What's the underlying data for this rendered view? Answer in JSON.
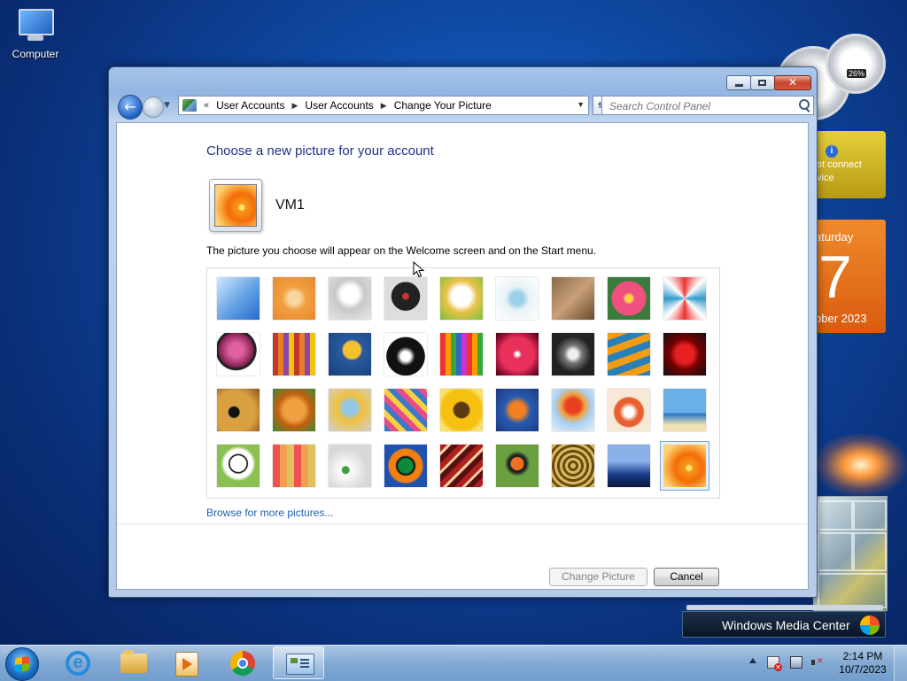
{
  "desktop": {
    "icons": [
      {
        "label": "Computer"
      }
    ]
  },
  "gadgets": {
    "cpu_meter": {
      "percent": "26%"
    },
    "weather": {
      "line1": "ot connect",
      "line2": "vice"
    },
    "calendar": {
      "day": "aturday",
      "date": "7",
      "month": "ober 2023"
    },
    "media_center": {
      "label": "Windows Media Center"
    }
  },
  "window": {
    "caption_buttons": {
      "minimize": "minimize",
      "maximize": "maximize",
      "close": "✕"
    },
    "address_bar": {
      "chevron": "«",
      "breadcrumbs": [
        "User Accounts",
        "User Accounts",
        "Change Your Picture"
      ]
    },
    "search": {
      "placeholder": "Search Control Panel"
    },
    "content": {
      "heading": "Choose a new picture for your account",
      "username": "VM1",
      "description": "The picture you choose will appear on the Welcome screen and on the Start menu.",
      "pictures": [
        {
          "name": "roller-coaster",
          "bg": "linear-gradient(135deg,#cfe6ff,#5a9ae0 60%,#2a6ad0)"
        },
        {
          "name": "starfish",
          "bg": "radial-gradient(circle,#f7d6a0 0 20%,#f0a040 40%,#e88830)"
        },
        {
          "name": "robot-toy",
          "bg": "radial-gradient(circle at 50% 40%,#ffffff 0 25%,#c8c8c8 45%,#e6e6e6)"
        },
        {
          "name": "record-player",
          "bg": "radial-gradient(circle at 50% 45%,#c33 0 10%,#222 12% 45%,#ddd 46%)"
        },
        {
          "name": "lucky-cat",
          "bg": "radial-gradient(circle at 50% 45%,#fff 0 30%,#e8c24a 50%,#7bbf3a)"
        },
        {
          "name": "spinning-top",
          "bg": "radial-gradient(circle at 50% 50%,#9ad0e8 0 20%,#e8f2f6 40%,#ffffff)"
        },
        {
          "name": "kitten",
          "bg": "linear-gradient(135deg,#8a6a4a,#c8a078 50%,#6a4a30)"
        },
        {
          "name": "dahlia",
          "bg": "radial-gradient(circle,#ffd24a 0 12%,#f05080 20% 55%,#3a7a3a 60%)"
        },
        {
          "name": "pinwheel",
          "bg": "conic-gradient(#e33,#fff,#39c,#fff,#e33,#fff,#39c,#fff,#e33)"
        },
        {
          "name": "ball",
          "bg": "radial-gradient(circle at 45% 40%,#e060a0 0 20%,#802050 50%,#222 52% 58%,#fff 60%)"
        },
        {
          "name": "fabric-stripes",
          "bg": "repeating-linear-gradient(90deg,#c0392b 0 6px,#e67e22 6px 12px,#8e44ad 12px 18px,#f1c40f 18px 24px)"
        },
        {
          "name": "leaf-on-blue",
          "bg": "radial-gradient(circle at 55% 40%,#f5c030 0 25%,#2a5aa0 30%,#18407a)"
        },
        {
          "name": "dog",
          "bg": "radial-gradient(circle at 50% 55%,#fff 0 15%,#111 30% 60%,#fff 62%)"
        },
        {
          "name": "crayons",
          "bg": "repeating-linear-gradient(90deg,#e33 0 6px,#f90 6px 12px,#3a3 12px 18px,#36c 18px 24px,#c3c 24px 30px)"
        },
        {
          "name": "star-lantern",
          "bg": "radial-gradient(circle,#fff 0 5%,#e8305a 15% 55%,#b01840 70%,#400010)"
        },
        {
          "name": "jacks",
          "bg": "radial-gradient(circle,#eee 0 15%,#777 30%,#222 60%)"
        },
        {
          "name": "stairs",
          "bg": "repeating-linear-gradient(160deg,#f39c12 0 8px,#2980b9 8px 16px)"
        },
        {
          "name": "paper-crane",
          "bg": "radial-gradient(circle at 50% 50%,#e62020 0 30%,#700 50%,#111)"
        },
        {
          "name": "guitar",
          "bg": "radial-gradient(circle at 40% 55%,#111 0 15%,#d9a040 18% 60%,#8a5020)"
        },
        {
          "name": "pomeranian",
          "bg": "radial-gradient(circle at 50% 50%,#f0a040 0 35%,#c06010 55%,#3a8a3a)"
        },
        {
          "name": "robot-bot",
          "bg": "radial-gradient(circle at 50% 45%,#90c8e8 0 20%,#f0c040 40%,#d0d0d0)"
        },
        {
          "name": "scarves",
          "bg": "repeating-linear-gradient(45deg,#3a7ac8 0 6px,#e84a8a 6px 12px,#f5d040 12px 18px)"
        },
        {
          "name": "sunflower",
          "bg": "radial-gradient(circle,#5a3a10 0 25%,#f5c010 30% 65%,#f8e070 80%)"
        },
        {
          "name": "fish",
          "bg": "radial-gradient(circle at 50% 50%,#f08020 0 25%,#2a5ab0 45%,#1a3a80)"
        },
        {
          "name": "balloon",
          "bg": "radial-gradient(circle at 50% 40%,#e84020 0 22%,#f0a040 35%,#a8d0f0 55%,#e8f0f8)"
        },
        {
          "name": "daruma",
          "bg": "radial-gradient(circle at 50% 55%,#fff 0 15%,#e86030 30% 45%,#f8e8d8 50%)"
        },
        {
          "name": "sailboat",
          "bg": "linear-gradient(180deg,#6ab0e8 0 55%,#2a7ac8 60%,#f0e0b0 85%)"
        },
        {
          "name": "soccer-ball",
          "bg": "radial-gradient(circle at 50% 45%,#fff 0 25%,#222 27% 30%,#fff 32% 45%,#8ac050 55%)"
        },
        {
          "name": "fabric-squares",
          "bg": "repeating-linear-gradient(90deg,#f05050 0 8px,#f0a050 8px 16px,#e0c060 16px 24px)"
        },
        {
          "name": "marbles",
          "bg": "radial-gradient(circle at 40% 60%,#40a040 0 10%,#fff 12%,#d8d8d8 60%)"
        },
        {
          "name": "window-frame",
          "bg": "radial-gradient(circle,#0a8a3a 0 25%,#111 27% 30%,#f08010 35% 55%,#2050b0 60%)"
        },
        {
          "name": "tapestry",
          "bg": "repeating-linear-gradient(135deg,#b02020 0 6px,#f0d0a0 6px 9px,#5a1010 9px 15px)"
        },
        {
          "name": "butterfly",
          "bg": "radial-gradient(circle at 50% 45%,#f07020 0 20%,#222 22% 28%,#6aa040 40%)"
        },
        {
          "name": "shell-spiral",
          "bg": "repeating-radial-gradient(circle,#d8b860 0 3px,#6a4a10 3px 6px)"
        },
        {
          "name": "lighthouse",
          "bg": "linear-gradient(180deg,#8ab0e8 0 40%,#1a3a8a 70%,#081838)"
        },
        {
          "name": "orange-flower",
          "bg": "radial-gradient(circle at 60% 55%,#ffe36a 0 8%,#f79a1c 10%,#f36c08 40%,#f9a43b 60%,#ffd27a 80%)",
          "selected": true
        }
      ],
      "browse_link": "Browse for more pictures...",
      "buttons": {
        "change_picture": "Change Picture",
        "cancel": "Cancel"
      }
    }
  },
  "taskbar": {
    "items": [
      {
        "name": "internet-explorer"
      },
      {
        "name": "windows-explorer"
      },
      {
        "name": "windows-media-player"
      },
      {
        "name": "google-chrome"
      },
      {
        "name": "control-panel",
        "active": true
      }
    ],
    "clock": {
      "time": "2:14 PM",
      "date": "10/7/2023"
    }
  },
  "icons": {
    "computer": "computer-icon",
    "back": "back-arrow-icon",
    "forward": "forward-arrow-icon",
    "address": "control-panel-icon",
    "refresh": "refresh-icon",
    "search": "search-icon",
    "start": "windows-logo-icon"
  }
}
